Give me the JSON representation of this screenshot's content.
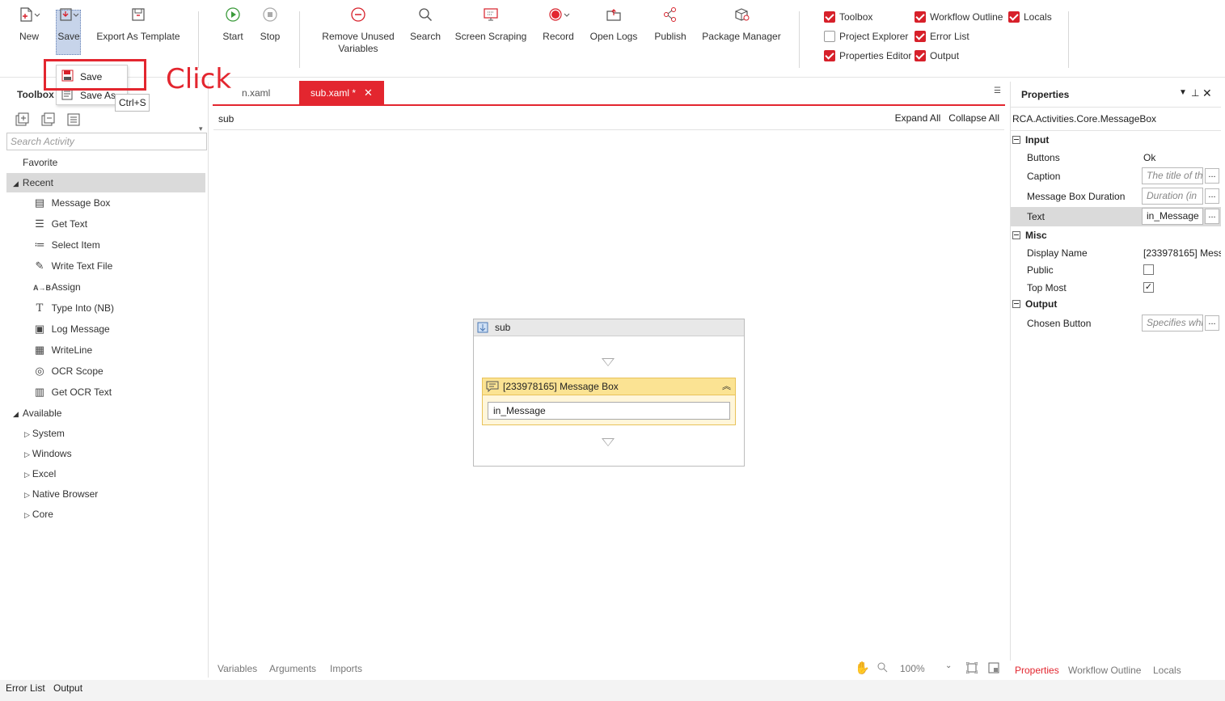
{
  "ribbon": {
    "new_label": "New",
    "save_label": "Save",
    "export_label": "Export As Template",
    "start_label": "Start",
    "stop_label": "Stop",
    "remove_unused_label": "Remove Unused Variables",
    "search_label": "Search",
    "screen_scraping_label": "Screen Scraping",
    "record_label": "Record",
    "open_logs_label": "Open Logs",
    "publish_label": "Publish",
    "package_manager_label": "Package Manager"
  },
  "panels": {
    "toolbox": {
      "label": "Toolbox",
      "checked": true
    },
    "workflow_outline": {
      "label": "Workflow Outline",
      "checked": true
    },
    "locals": {
      "label": "Locals",
      "checked": true
    },
    "project_explorer": {
      "label": "Project Explorer",
      "checked": false
    },
    "error_list": {
      "label": "Error List",
      "checked": true
    },
    "properties_editor": {
      "label": "Properties Editor",
      "checked": true
    },
    "output": {
      "label": "Output",
      "checked": true
    }
  },
  "save_menu": {
    "save": "Save",
    "save_as": "Save As",
    "shortcut": "Ctrl+S"
  },
  "annotation": {
    "click_text": "Click",
    "color": "#e3262f"
  },
  "toolbox": {
    "title": "Toolbox",
    "search_placeholder": "Search Activity",
    "favorite": "Favorite",
    "recent": "Recent",
    "recent_items": [
      {
        "label": "Message Box",
        "icon": "message-box-icon"
      },
      {
        "label": "Get Text",
        "icon": "get-text-icon"
      },
      {
        "label": "Select Item",
        "icon": "select-item-icon"
      },
      {
        "label": "Write Text File",
        "icon": "write-text-file-icon"
      },
      {
        "label": "Assign",
        "icon": "assign-icon"
      },
      {
        "label": "Type Into (NB)",
        "icon": "type-into-icon"
      },
      {
        "label": "Log Message",
        "icon": "log-message-icon"
      },
      {
        "label": "WriteLine",
        "icon": "writeline-icon"
      },
      {
        "label": "OCR Scope",
        "icon": "ocr-scope-icon"
      },
      {
        "label": "Get OCR Text",
        "icon": "get-ocr-text-icon"
      }
    ],
    "available": "Available",
    "available_groups": [
      "System",
      "Windows",
      "Excel",
      "Native Browser",
      "Core"
    ]
  },
  "tabs": [
    {
      "label": "main.xaml",
      "visible_label": "n.xaml"
    },
    {
      "label": "sub.xaml *"
    }
  ],
  "designer": {
    "breadcrumb": "sub",
    "expand_all": "Expand All",
    "collapse_all": "Collapse All",
    "sequence_title": "sub",
    "activity_title": "[233978165] Message Box",
    "activity_text": "in_Message",
    "bottom_tabs": [
      "Variables",
      "Arguments",
      "Imports"
    ],
    "zoom": "100%"
  },
  "properties": {
    "title": "Properties",
    "type_name": "RCA.Activities.Core.MessageBox",
    "input_label": "Input",
    "buttons_label": "Buttons",
    "buttons_value": "Ok",
    "caption_label": "Caption",
    "caption_placeholder": "The title of th",
    "duration_label": "Message Box Duration",
    "duration_placeholder": "Duration (in",
    "text_label": "Text",
    "text_value": "in_Message",
    "misc_label": "Misc",
    "display_name_label": "Display Name",
    "display_name_value": "[233978165] Mess",
    "public_label": "Public",
    "public_checked": false,
    "top_most_label": "Top Most",
    "top_most_checked": true,
    "output_label": "Output",
    "chosen_button_label": "Chosen Button",
    "chosen_button_placeholder": "Specifies whi",
    "dots": "...",
    "bottom_tabs": [
      "Properties",
      "Workflow Outline",
      "Locals"
    ]
  },
  "statusbar": {
    "error_list": "Error List",
    "output": "Output"
  }
}
